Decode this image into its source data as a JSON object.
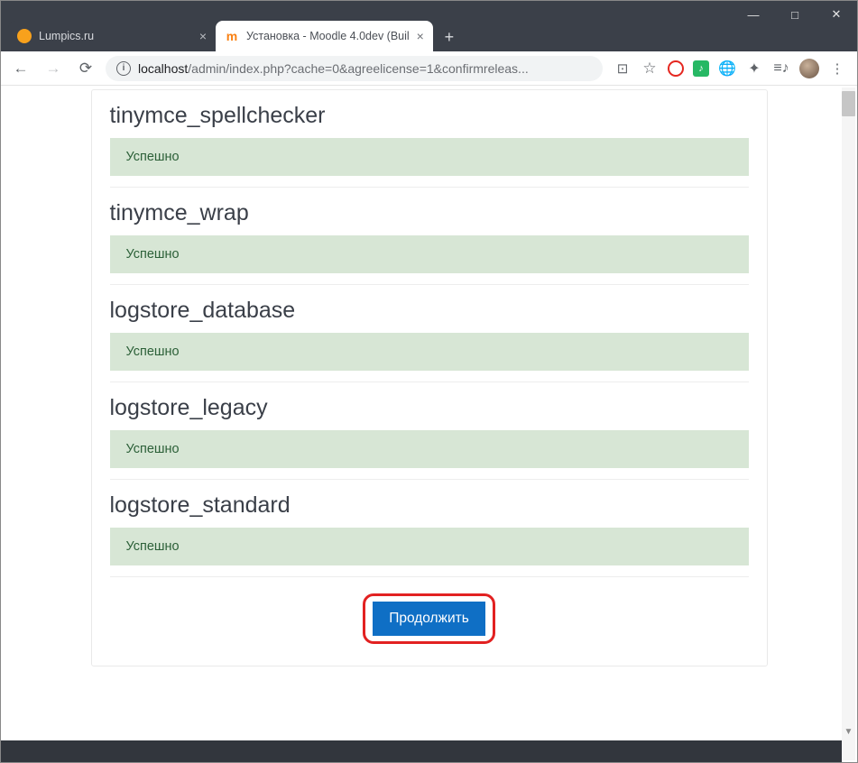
{
  "window": {
    "minimize": "—",
    "maximize": "□",
    "close": "✕"
  },
  "tabs": [
    {
      "title": "Lumpics.ru",
      "active": false
    },
    {
      "title": "Установка - Moodle 4.0dev (Buil",
      "active": true
    }
  ],
  "newtab": "+",
  "address": {
    "host": "localhost",
    "path": "/admin/index.php?cache=0&agreelicense=1&confirmreleas..."
  },
  "plugins": [
    {
      "name": "tinymce_spellchecker",
      "status": "Успешно"
    },
    {
      "name": "tinymce_wrap",
      "status": "Успешно"
    },
    {
      "name": "logstore_database",
      "status": "Успешно"
    },
    {
      "name": "logstore_legacy",
      "status": "Успешно"
    },
    {
      "name": "logstore_standard",
      "status": "Успешно"
    }
  ],
  "button": {
    "continue": "Продолжить"
  }
}
